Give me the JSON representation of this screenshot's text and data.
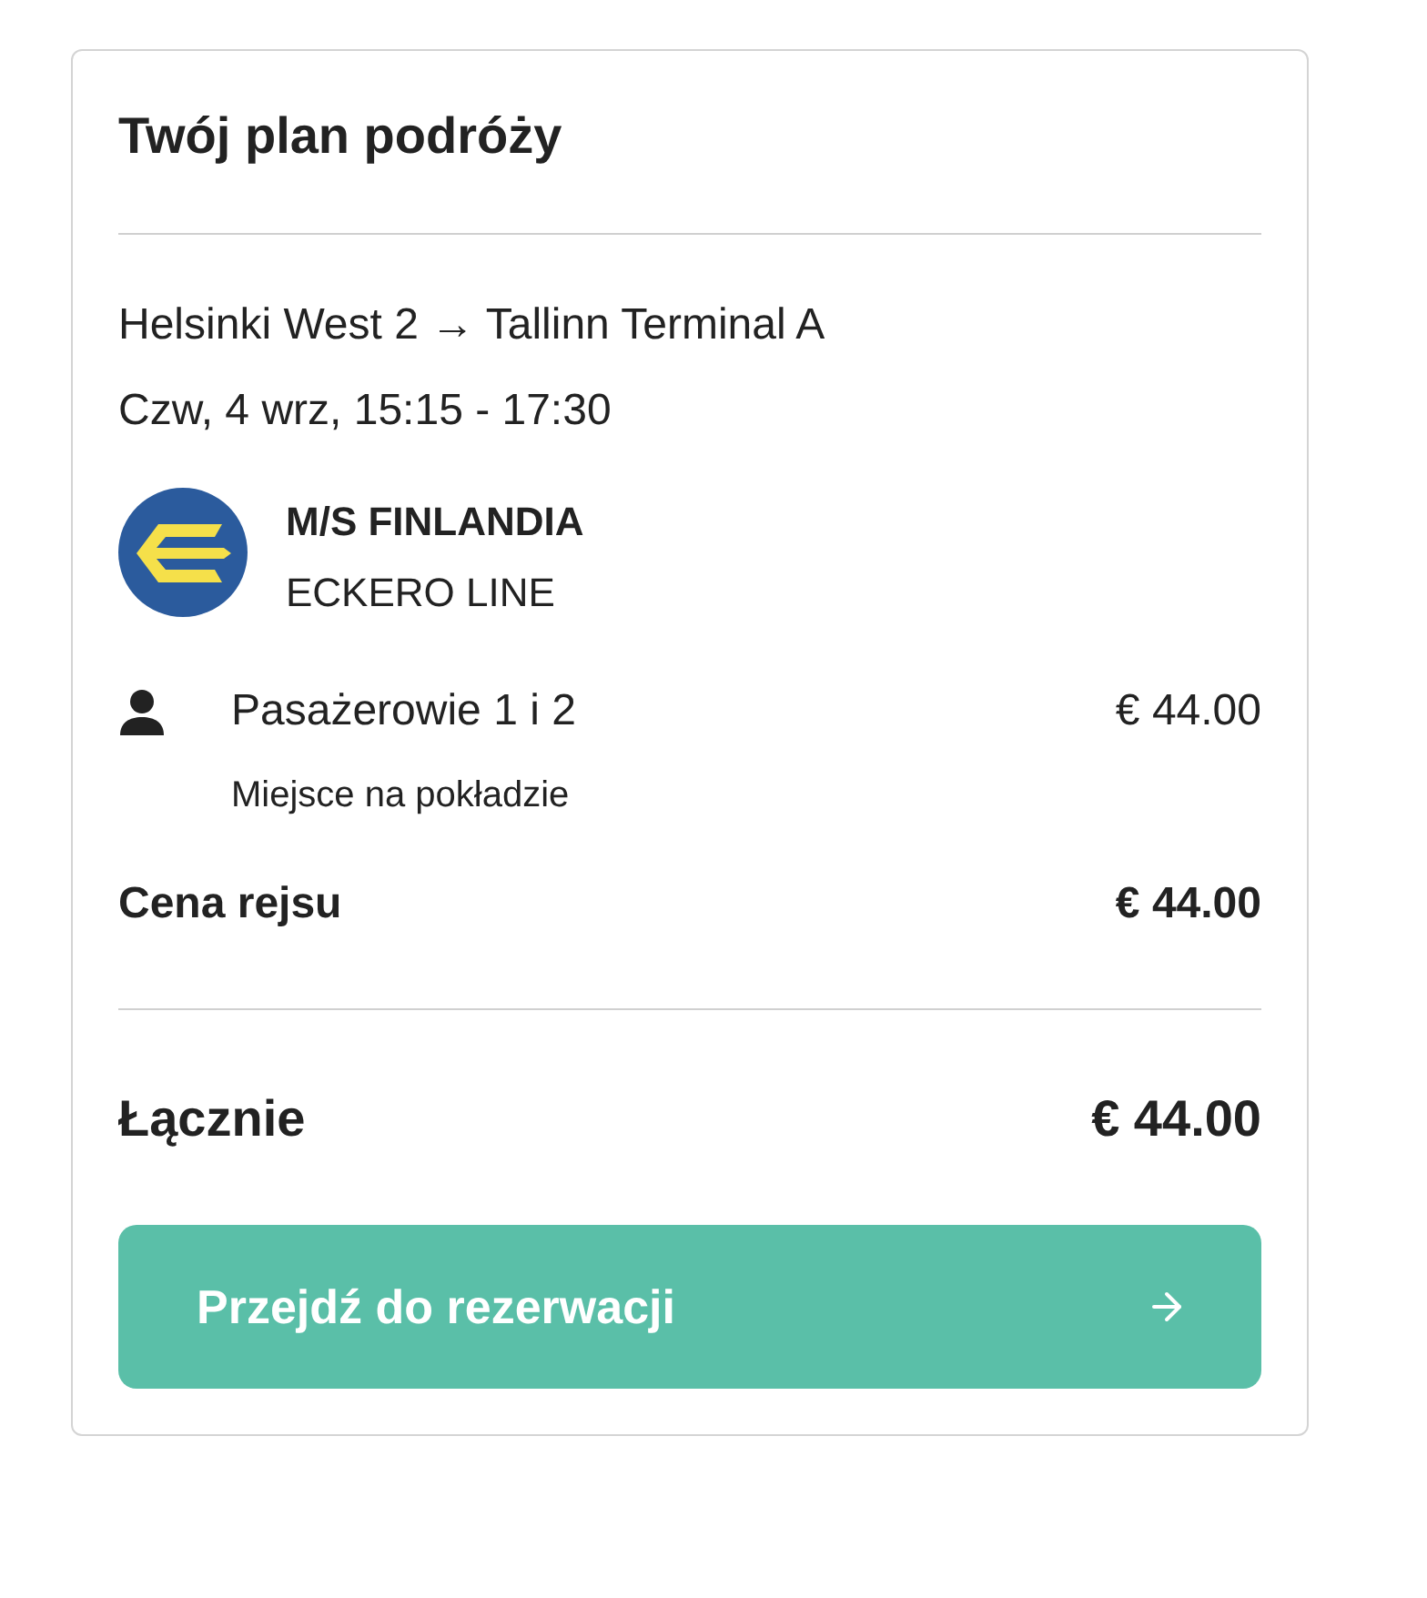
{
  "card": {
    "title": "Twój plan podróży",
    "trip": {
      "route": "Helsinki West 2 → Tallinn Terminal A",
      "datetime": "Czw, 4 wrz, 15:15 - 17:30",
      "vessel": "M/S FINLANDIA",
      "operator": "ECKERO LINE"
    },
    "passengers": [
      {
        "label": "Pasażerowie 1 i 2",
        "price": "€ 44.00",
        "detail": "Miejsce na pokładzie"
      }
    ],
    "trip_price": {
      "label": "Cena rejsu",
      "value": "€ 44.00"
    },
    "total": {
      "label": "Łącznie",
      "value": "€ 44.00"
    },
    "button": {
      "label": "Przejdź do rezerwacji"
    }
  }
}
